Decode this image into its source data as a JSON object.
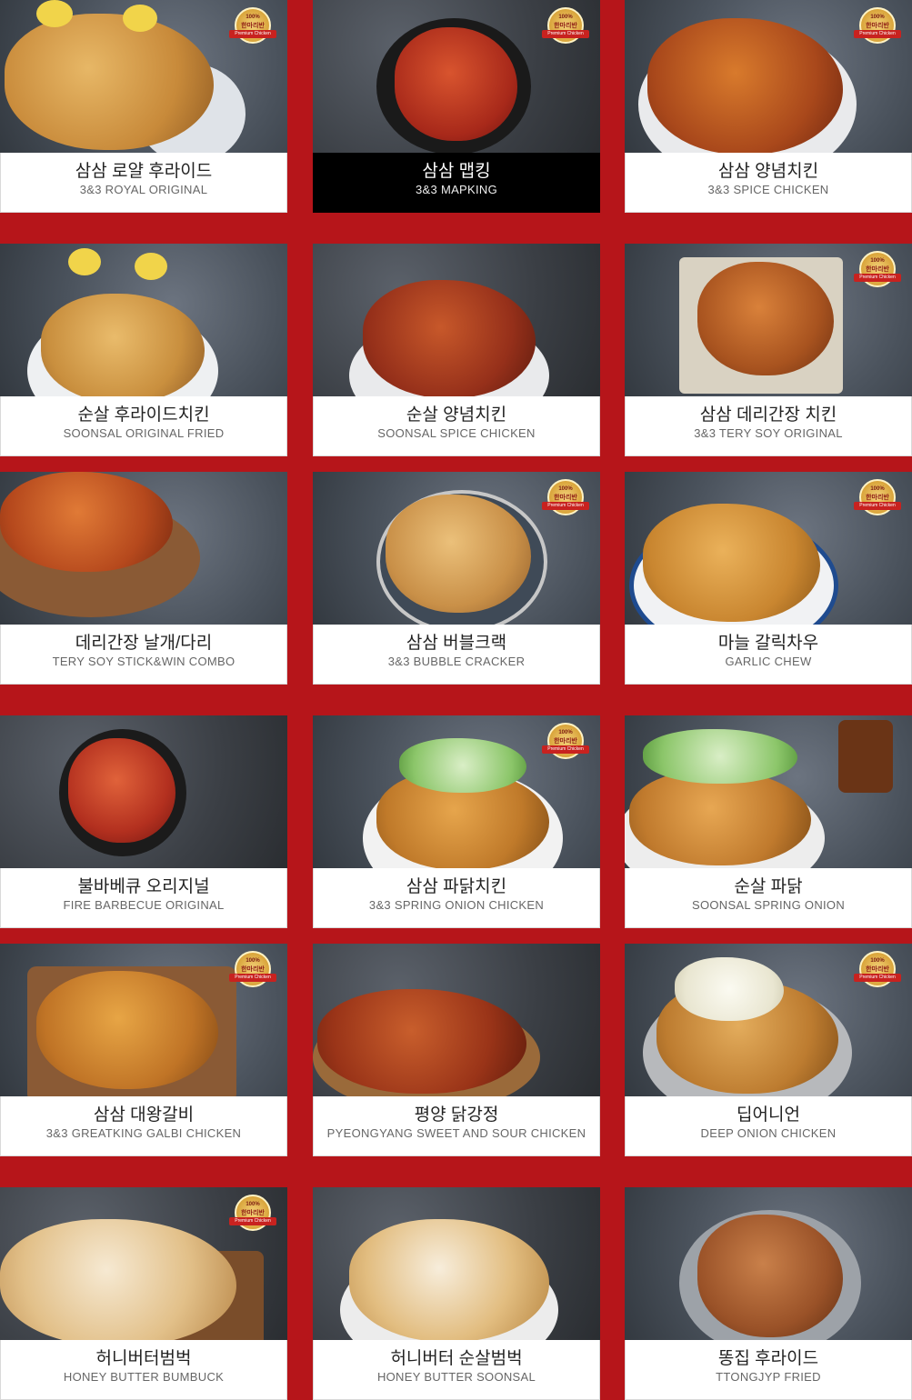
{
  "badge": {
    "top": "100%",
    "mid": "한마리반",
    "sub": "Premium Chicken"
  },
  "menu": [
    {
      "kr": "삼삼 로얄 후라이드",
      "en": "3&3 ROYAL ORIGINAL"
    },
    {
      "kr": "삼삼 맵킹",
      "en": "3&3 MAPKING"
    },
    {
      "kr": "삼삼 양념치킨",
      "en": "3&3 SPICE CHICKEN"
    },
    {
      "kr": "순살 후라이드치킨",
      "en": "SOONSAL ORIGINAL FRIED"
    },
    {
      "kr": "순살 양념치킨",
      "en": "SOONSAL SPICE CHICKEN"
    },
    {
      "kr": "삼삼 데리간장 치킨",
      "en": "3&3 TERY SOY ORIGINAL"
    },
    {
      "kr": "데리간장 날개/다리",
      "en": "TERY SOY STICK&WIN COMBO"
    },
    {
      "kr": "삼삼 버블크랙",
      "en": "3&3 BUBBLE CRACKER"
    },
    {
      "kr": "마늘 갈릭차우",
      "en": "GARLIC CHEW"
    },
    {
      "kr": "불바베큐 오리지널",
      "en": "FIRE BARBECUE ORIGINAL"
    },
    {
      "kr": "삼삼 파닭치킨",
      "en": "3&3 SPRING ONION CHICKEN"
    },
    {
      "kr": "순살 파닭",
      "en": "SOONSAL SPRING ONION"
    },
    {
      "kr": "삼삼 대왕갈비",
      "en": "3&3 GREATKING GALBI CHICKEN"
    },
    {
      "kr": "평양 닭강정",
      "en": "PYEONGYANG SWEET AND SOUR CHICKEN"
    },
    {
      "kr": "딥어니언",
      "en": "DEEP ONION CHICKEN"
    },
    {
      "kr": "허니버터범벅",
      "en": "HONEY BUTTER BUMBUCK"
    },
    {
      "kr": "허니버터 순살범벅",
      "en": "HONEY BUTTER SOONSAL"
    },
    {
      "kr": "똥집 후라이드",
      "en": "TTONGJYP FRIED"
    }
  ]
}
